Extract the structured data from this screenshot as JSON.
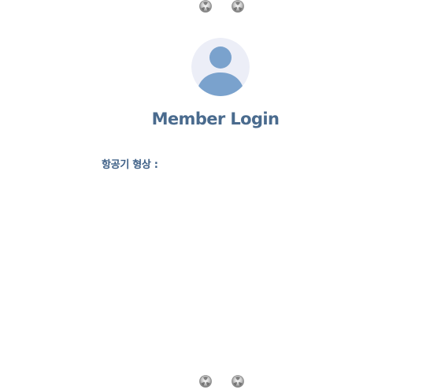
{
  "login": {
    "title": "Member Login",
    "field_label": "항공기 형상 :"
  },
  "colors": {
    "title": "#4a6b8e",
    "label": "#3d5f86",
    "avatar_bg": "#eceef7",
    "avatar_figure": "#7aa2cd"
  },
  "icons": {
    "avatar": "user-avatar-icon",
    "decorations": [
      "rivet-icon",
      "rivet-icon",
      "rivet-icon",
      "rivet-icon"
    ]
  }
}
